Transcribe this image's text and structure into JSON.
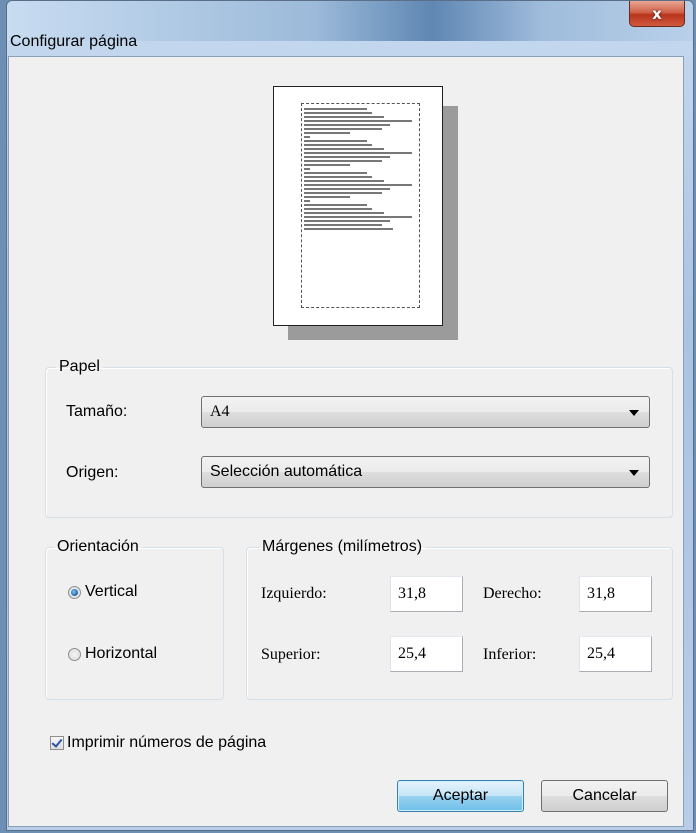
{
  "window": {
    "title": "Configurar página",
    "close_glyph": "x"
  },
  "paper": {
    "legend": "Papel",
    "size_label": "Tamaño:",
    "size_value": "A4",
    "source_label": "Origen:",
    "source_value": "Selección automática"
  },
  "orientation": {
    "legend": "Orientación",
    "options": [
      {
        "label": "Vertical",
        "selected": true
      },
      {
        "label": "Horizontal",
        "selected": false
      }
    ]
  },
  "margins": {
    "legend": "Márgenes (milímetros)",
    "left_label": "Izquierdo:",
    "left_value": "31,8",
    "right_label": "Derecho:",
    "right_value": "31,8",
    "top_label": "Superior:",
    "top_value": "25,4",
    "bottom_label": "Inferior:",
    "bottom_value": "25,4"
  },
  "print_page_numbers": {
    "label": "Imprimir números de página",
    "checked": true
  },
  "buttons": {
    "ok": "Aceptar",
    "cancel": "Cancelar"
  },
  "icons": [
    "close-icon",
    "dropdown-arrow-icon",
    "radio-icon",
    "checkbox-icon"
  ]
}
